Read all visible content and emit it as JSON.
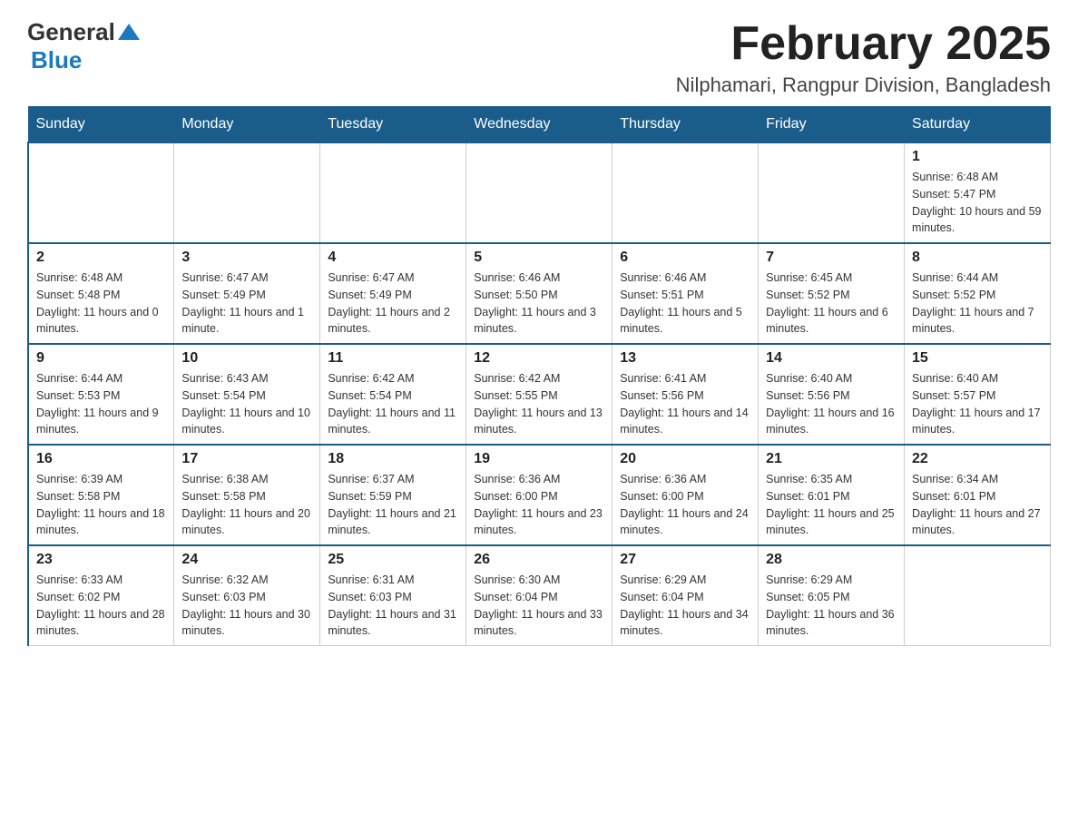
{
  "logo": {
    "general": "General",
    "blue": "Blue"
  },
  "title": "February 2025",
  "subtitle": "Nilphamari, Rangpur Division, Bangladesh",
  "weekdays": [
    "Sunday",
    "Monday",
    "Tuesday",
    "Wednesday",
    "Thursday",
    "Friday",
    "Saturday"
  ],
  "weeks": [
    [
      {
        "day": "",
        "info": ""
      },
      {
        "day": "",
        "info": ""
      },
      {
        "day": "",
        "info": ""
      },
      {
        "day": "",
        "info": ""
      },
      {
        "day": "",
        "info": ""
      },
      {
        "day": "",
        "info": ""
      },
      {
        "day": "1",
        "info": "Sunrise: 6:48 AM\nSunset: 5:47 PM\nDaylight: 10 hours and 59 minutes."
      }
    ],
    [
      {
        "day": "2",
        "info": "Sunrise: 6:48 AM\nSunset: 5:48 PM\nDaylight: 11 hours and 0 minutes."
      },
      {
        "day": "3",
        "info": "Sunrise: 6:47 AM\nSunset: 5:49 PM\nDaylight: 11 hours and 1 minute."
      },
      {
        "day": "4",
        "info": "Sunrise: 6:47 AM\nSunset: 5:49 PM\nDaylight: 11 hours and 2 minutes."
      },
      {
        "day": "5",
        "info": "Sunrise: 6:46 AM\nSunset: 5:50 PM\nDaylight: 11 hours and 3 minutes."
      },
      {
        "day": "6",
        "info": "Sunrise: 6:46 AM\nSunset: 5:51 PM\nDaylight: 11 hours and 5 minutes."
      },
      {
        "day": "7",
        "info": "Sunrise: 6:45 AM\nSunset: 5:52 PM\nDaylight: 11 hours and 6 minutes."
      },
      {
        "day": "8",
        "info": "Sunrise: 6:44 AM\nSunset: 5:52 PM\nDaylight: 11 hours and 7 minutes."
      }
    ],
    [
      {
        "day": "9",
        "info": "Sunrise: 6:44 AM\nSunset: 5:53 PM\nDaylight: 11 hours and 9 minutes."
      },
      {
        "day": "10",
        "info": "Sunrise: 6:43 AM\nSunset: 5:54 PM\nDaylight: 11 hours and 10 minutes."
      },
      {
        "day": "11",
        "info": "Sunrise: 6:42 AM\nSunset: 5:54 PM\nDaylight: 11 hours and 11 minutes."
      },
      {
        "day": "12",
        "info": "Sunrise: 6:42 AM\nSunset: 5:55 PM\nDaylight: 11 hours and 13 minutes."
      },
      {
        "day": "13",
        "info": "Sunrise: 6:41 AM\nSunset: 5:56 PM\nDaylight: 11 hours and 14 minutes."
      },
      {
        "day": "14",
        "info": "Sunrise: 6:40 AM\nSunset: 5:56 PM\nDaylight: 11 hours and 16 minutes."
      },
      {
        "day": "15",
        "info": "Sunrise: 6:40 AM\nSunset: 5:57 PM\nDaylight: 11 hours and 17 minutes."
      }
    ],
    [
      {
        "day": "16",
        "info": "Sunrise: 6:39 AM\nSunset: 5:58 PM\nDaylight: 11 hours and 18 minutes."
      },
      {
        "day": "17",
        "info": "Sunrise: 6:38 AM\nSunset: 5:58 PM\nDaylight: 11 hours and 20 minutes."
      },
      {
        "day": "18",
        "info": "Sunrise: 6:37 AM\nSunset: 5:59 PM\nDaylight: 11 hours and 21 minutes."
      },
      {
        "day": "19",
        "info": "Sunrise: 6:36 AM\nSunset: 6:00 PM\nDaylight: 11 hours and 23 minutes."
      },
      {
        "day": "20",
        "info": "Sunrise: 6:36 AM\nSunset: 6:00 PM\nDaylight: 11 hours and 24 minutes."
      },
      {
        "day": "21",
        "info": "Sunrise: 6:35 AM\nSunset: 6:01 PM\nDaylight: 11 hours and 25 minutes."
      },
      {
        "day": "22",
        "info": "Sunrise: 6:34 AM\nSunset: 6:01 PM\nDaylight: 11 hours and 27 minutes."
      }
    ],
    [
      {
        "day": "23",
        "info": "Sunrise: 6:33 AM\nSunset: 6:02 PM\nDaylight: 11 hours and 28 minutes."
      },
      {
        "day": "24",
        "info": "Sunrise: 6:32 AM\nSunset: 6:03 PM\nDaylight: 11 hours and 30 minutes."
      },
      {
        "day": "25",
        "info": "Sunrise: 6:31 AM\nSunset: 6:03 PM\nDaylight: 11 hours and 31 minutes."
      },
      {
        "day": "26",
        "info": "Sunrise: 6:30 AM\nSunset: 6:04 PM\nDaylight: 11 hours and 33 minutes."
      },
      {
        "day": "27",
        "info": "Sunrise: 6:29 AM\nSunset: 6:04 PM\nDaylight: 11 hours and 34 minutes."
      },
      {
        "day": "28",
        "info": "Sunrise: 6:29 AM\nSunset: 6:05 PM\nDaylight: 11 hours and 36 minutes."
      },
      {
        "day": "",
        "info": ""
      }
    ]
  ]
}
